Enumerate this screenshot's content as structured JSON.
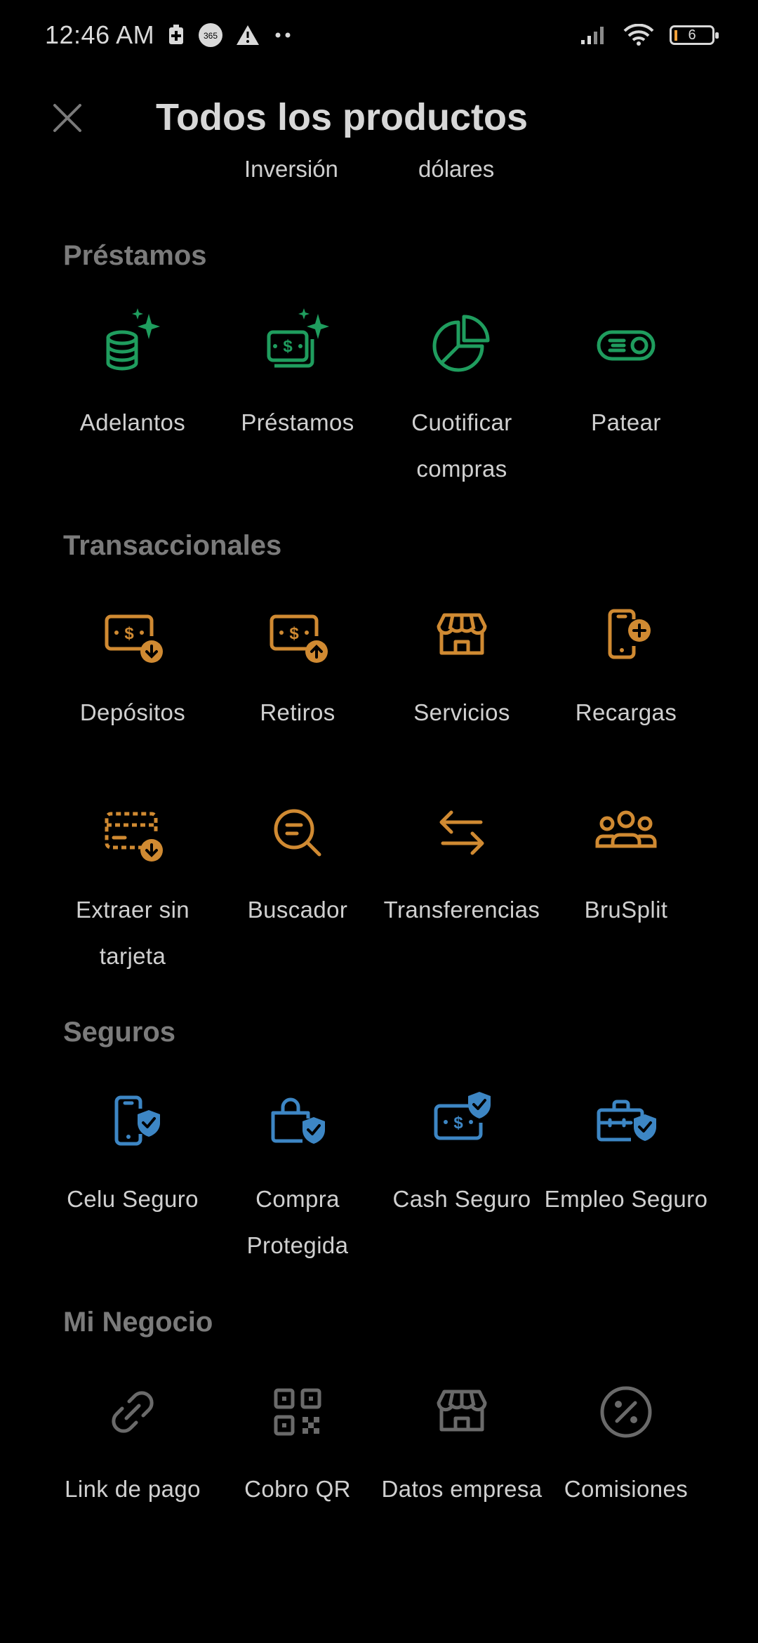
{
  "status_bar": {
    "time": "12:46 AM",
    "battery": "6"
  },
  "header": {
    "title": "Todos los productos",
    "close_icon": "close-icon"
  },
  "subtabs": [
    "Inversión",
    "dólares"
  ],
  "colors": {
    "green": "#1f9d5e",
    "orange": "#d08a32",
    "blue": "#3d86c4",
    "gray": "#6a6a6a"
  },
  "sections": {
    "prestamos": {
      "title": "Préstamos",
      "items": [
        {
          "label": "Adelantos",
          "icon": "coins-sparkle-icon"
        },
        {
          "label": "Préstamos",
          "icon": "cash-sparkle-icon"
        },
        {
          "label": "Cuotificar compras",
          "icon": "pie-chart-icon"
        },
        {
          "label": "Patear",
          "icon": "fast-toggle-icon"
        }
      ]
    },
    "transaccionales": {
      "title": "Transaccionales",
      "items": [
        {
          "label": "Depósitos",
          "icon": "cash-down-icon"
        },
        {
          "label": "Retiros",
          "icon": "cash-up-icon"
        },
        {
          "label": "Servicios",
          "icon": "store-icon"
        },
        {
          "label": "Recargas",
          "icon": "phone-plus-icon"
        },
        {
          "label": "Extraer sin tarjeta",
          "icon": "card-download-icon"
        },
        {
          "label": "Buscador",
          "icon": "search-icon"
        },
        {
          "label": "Transferencias",
          "icon": "transfer-arrows-icon"
        },
        {
          "label": "BruSplit",
          "icon": "group-icon"
        }
      ]
    },
    "seguros": {
      "title": "Seguros",
      "items": [
        {
          "label": "Celu Seguro",
          "icon": "phone-shield-icon"
        },
        {
          "label": "Compra Protegida",
          "icon": "bag-shield-icon"
        },
        {
          "label": "Cash Seguro",
          "icon": "cash-shield-icon"
        },
        {
          "label": "Empleo Seguro",
          "icon": "briefcase-shield-icon"
        }
      ]
    },
    "negocio": {
      "title": "Mi Negocio",
      "items": [
        {
          "label": "Link de pago",
          "icon": "link-icon"
        },
        {
          "label": "Cobro QR",
          "icon": "qr-icon"
        },
        {
          "label": "Datos empresa",
          "icon": "store-icon"
        },
        {
          "label": "Comisiones",
          "icon": "percent-icon"
        }
      ]
    }
  }
}
